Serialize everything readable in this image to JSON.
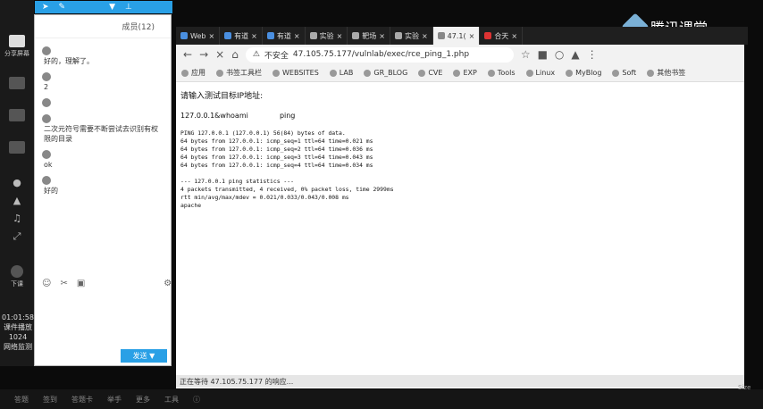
{
  "left_toolbar": {
    "share_label": "分享屏幕",
    "download_label": "下课",
    "timer": "01:01:58",
    "live_label": "课件播放",
    "live_value": "1024",
    "net_label": "网络监测"
  },
  "chat": {
    "member_count": "成员(12)",
    "messages": [
      {
        "name": "",
        "text": "好的，理解了。"
      },
      {
        "name": "",
        "text": "2"
      },
      {
        "name": "",
        "text": ""
      },
      {
        "name": "",
        "text": "二次元符号需要不断尝试去识别有权限的目录"
      },
      {
        "name": "",
        "text": "ok"
      },
      {
        "name": "",
        "text": "好的"
      }
    ],
    "send_label": "发送"
  },
  "brand": {
    "name": "腾讯课堂"
  },
  "browser": {
    "tabs": [
      {
        "label": "Web"
      },
      {
        "label": "有道"
      },
      {
        "label": "有道"
      },
      {
        "label": "实验"
      },
      {
        "label": "靶场"
      },
      {
        "label": "实验"
      },
      {
        "label": "47.1("
      },
      {
        "label": "合天"
      }
    ],
    "address_security": "不安全",
    "address_url": "47.105.75.177/vulnlab/exec/rce_ping_1.php",
    "bookmarks": [
      "应用",
      "书签工具栏",
      "WEBSITES",
      "LAB",
      "GR_BLOG",
      "CVE",
      "EXP",
      "Tools",
      "Linux",
      "MyBlog",
      "Soft",
      "其他书签"
    ],
    "page": {
      "prompt": "请输入测试目标IP地址:",
      "input_value": "127.0.0.1&whoami",
      "button_label": "ping",
      "output": "PING 127.0.0.1 (127.0.0.1) 56(84) bytes of data.\n64 bytes from 127.0.0.1: icmp_seq=1 ttl=64 time=0.021 ms\n64 bytes from 127.0.0.1: icmp_seq=2 ttl=64 time=0.036 ms\n64 bytes from 127.0.0.1: icmp_seq=3 ttl=64 time=0.043 ms\n64 bytes from 127.0.0.1: icmp_seq=4 ttl=64 time=0.034 ms\n\n--- 127.0.0.1 ping statistics ---\n4 packets transmitted, 4 received, 0% packet loss, time 2999ms\nrtt min/avg/max/mdev = 0.021/0.033/0.043/0.008 ms\napache"
    },
    "status_text": "正在等待 47.105.75.177 的响应..."
  },
  "taskbar": {
    "items": [
      "答题",
      "签到",
      "答题卡",
      "举手",
      "更多",
      "工具"
    ],
    "right_text": "Size"
  }
}
